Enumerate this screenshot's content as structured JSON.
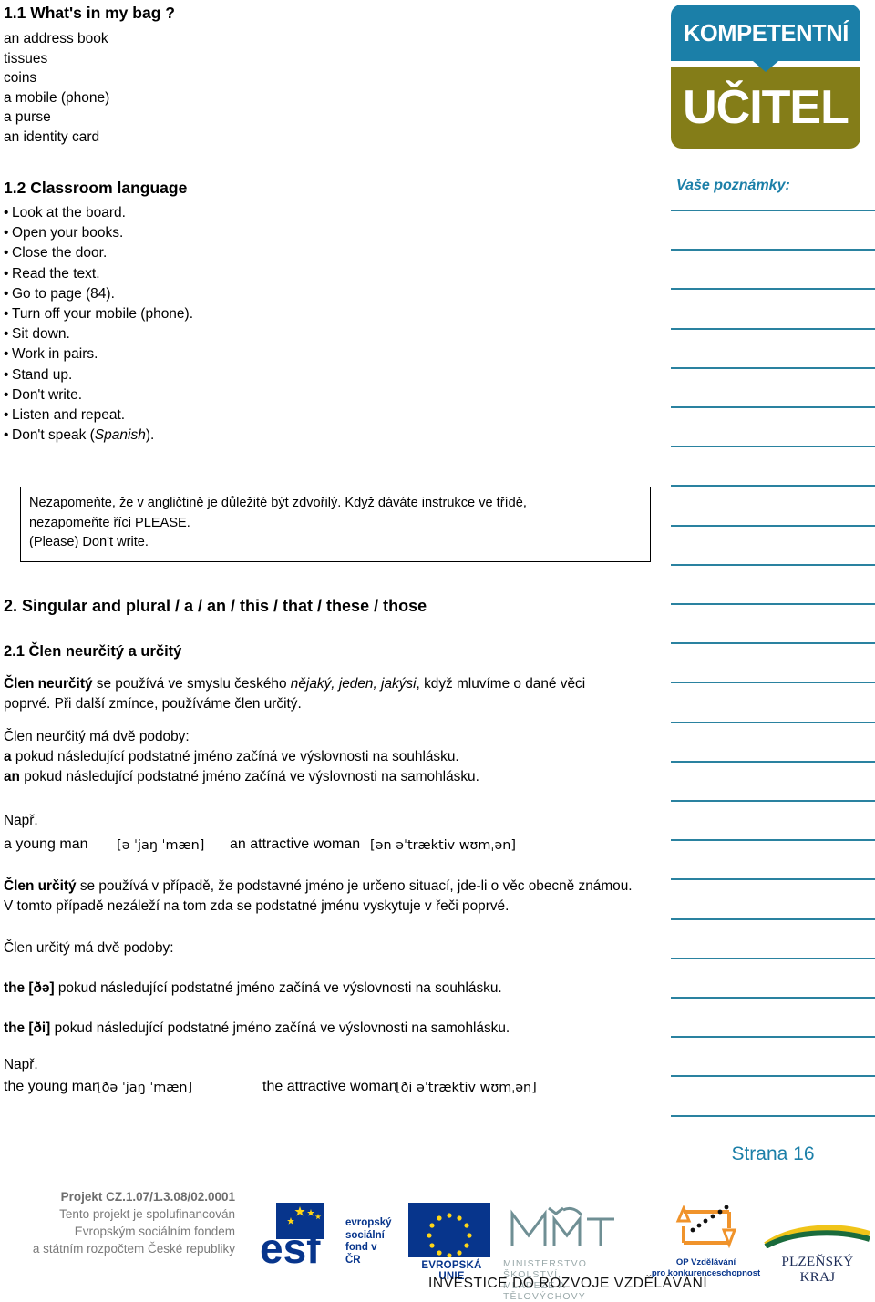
{
  "logo": {
    "top_word": "KOMPETENTNÍ",
    "bottom_word": "UČITEL",
    "blue": "#1b7fa8",
    "olive": "#847d18"
  },
  "section_1_1": {
    "title": "1.1 What's in my bag ?",
    "items": [
      "an address book",
      "tissues",
      "coins",
      "a mobile (phone)",
      "a purse",
      "an identity card"
    ]
  },
  "section_1_2": {
    "title": "1.2 Classroom language",
    "items": [
      "Look at the board.",
      "Open your books.",
      "Close the door.",
      "Read the text.",
      "Go to page (84).",
      "Turn off your mobile (phone).",
      "Sit down.",
      "Work in pairs.",
      "Stand up.",
      "Don't write.",
      "Listen and repeat.",
      "Don't speak (Spanish)."
    ],
    "last_item_plain": "Don't speak (",
    "last_item_italic": "Spanish",
    "last_item_tail": ")."
  },
  "tip_box": {
    "line1": "Nezapomeňte, že v angličtině je důležité být zdvořilý. Když dáváte instrukce ve třídě,",
    "line2": "nezapomeňte říci PLEASE.",
    "line3": "(Please) Don't write."
  },
  "section_2": {
    "title": "2. Singular and plural / a / an / this / that / these / those",
    "sub_title": "2.1 Člen neurčitý a určitý",
    "indef": {
      "lead_bold": "Člen neurčitý",
      "lead_rest_1": " se používá ve smyslu českého ",
      "lead_italic": "nějaký, jeden, jakýsi",
      "lead_rest_2": ", když mluvíme o dané věci poprvé. Při další zmínce, používáme člen určitý.",
      "forms_intro": "Člen neurčitý má dvě podoby:",
      "form_a_marker": "a",
      "form_a_text": " pokud následující podstatné jméno začíná ve výslovnosti na souhlásku.",
      "form_an_marker": "an",
      "form_an_text": "  pokud následující podstatné jméno začíná ve výslovnosti na samohlásku.",
      "example_label": "Např.",
      "example_left": "a young man",
      "example_left_ipa": "[ə ˈjaŋ ˈmæn]",
      "example_right": "an attractive woman",
      "example_right_ipa": "[ən əˈtræktiv wʊmˌən]"
    },
    "def": {
      "lead_bold": "Člen určitý",
      "lead_rest": " se používá v případě, že podstavné jméno je určeno situací, jde-li o věc obecně známou. V tomto případě nezáleží na tom zda se podstatné jménu vyskytuje v řeči poprvé.",
      "forms_intro": "Člen určitý má dvě podoby:",
      "form_the_cons_marker": "the [ðə]",
      "form_the_cons_text": " pokud následující podstatné jméno začíná ve výslovnosti na souhlásku.",
      "form_the_vow_marker": "the [ði]",
      "form_the_vow_text": " pokud následující podstatné jméno začíná ve výslovnosti na samohlásku.",
      "example_label": "Např.",
      "example_left": "the young man",
      "example_left_ipa": "[ðə ˈjaŋ ˈmæn]",
      "example_right": "the attractive woman",
      "example_right_ipa": "[ði əˈtræktiv wʊmˌən]"
    }
  },
  "notes": {
    "title": "Vaše poznámky:",
    "line_color": "#2a82a0",
    "line_count": 24,
    "page_label": "Strana 16"
  },
  "footer": {
    "project_code": "Projekt CZ.1.07/1.3.08/02.0001",
    "line2": "Tento projekt je spolufinancován",
    "line3": "Evropským sociálním fondem",
    "line4": "a státním rozpočtem České republiky",
    "esf_line1": "evropský",
    "esf_line2": "sociální",
    "esf_line3": "fond v ČR",
    "eu_caption": "EVROPSKÁ UNIE",
    "msmt_line1": "MINISTERSTVO ŠKOLSTVÍ,",
    "msmt_line2": "MLÁDEŽE A TĚLOVÝCHOVY",
    "op_line1": "OP Vzdělávání",
    "op_line2": "pro konkurenceschopnost",
    "kraj": "PLZEŇSKÝ KRAJ",
    "tagline": "INVESTICE DO ROZVOJE VZDĚLÁVÁNÍ"
  }
}
